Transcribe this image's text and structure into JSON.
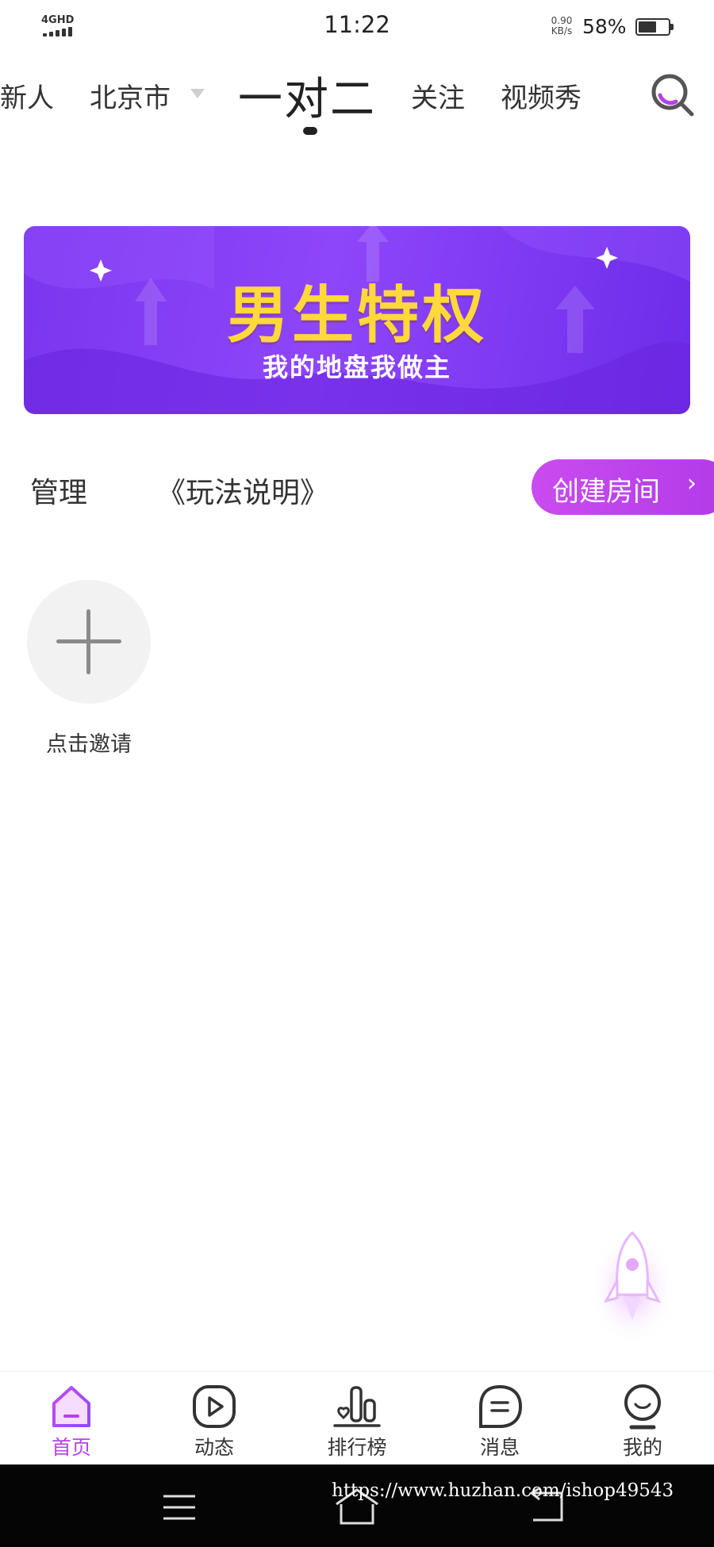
{
  "status_bar": {
    "network": "4GHD",
    "time": "11:22",
    "speed_value": "0.90",
    "speed_unit": "KB/s",
    "battery": "58%",
    "battery_level": 0.58
  },
  "top_tabs": [
    {
      "label": "新人"
    },
    {
      "label": "北京市"
    },
    {
      "label": "一对二",
      "active": true
    },
    {
      "label": "关注"
    },
    {
      "label": "视频秀"
    }
  ],
  "banner": {
    "title": "男生特权",
    "subtitle": "我的地盘我做主"
  },
  "actions": {
    "manage": "管理",
    "rules": "《玩法说明》",
    "create_room": "创建房间",
    "create_room_arrow": "›"
  },
  "invite": {
    "label": "点击邀请"
  },
  "bottom_nav": [
    {
      "label": "首页",
      "icon": "home-icon",
      "active": true
    },
    {
      "label": "动态",
      "icon": "play-icon"
    },
    {
      "label": "排行榜",
      "icon": "ranking-icon"
    },
    {
      "label": "消息",
      "icon": "message-icon"
    },
    {
      "label": "我的",
      "icon": "profile-icon"
    }
  ],
  "watermark": "https://www.huzhan.com/ishop49543",
  "colors": {
    "accent": "#b642e6",
    "banner_bg": "#8a42f8",
    "banner_title": "#ffd83a"
  }
}
